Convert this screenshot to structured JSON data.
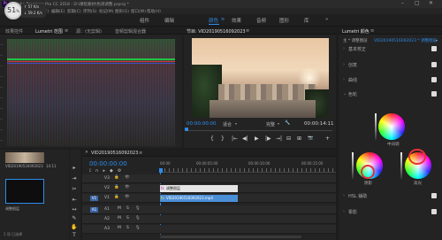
{
  "titlebar": {
    "app": "Pr",
    "title": "Adobe Premiere Pro CC 2018 - D:\\课程素材\\色调调整.prproj *"
  },
  "menu": [
    "文件(F)",
    "编辑(E)",
    "剪辑(C)",
    "序列(S)",
    "标记(M)",
    "图形(G)",
    "窗口(W)",
    "帮助(H)"
  ],
  "workspaces": {
    "items": [
      "组件",
      "编辑",
      "颜色",
      "效果",
      "音频",
      "图形",
      "库"
    ],
    "active_index": 2,
    "more": "»"
  },
  "speed_badge": {
    "percent": "51",
    "unit": "%",
    "up": "↑ 57 K/s",
    "down": "↓ 59.2 K/s"
  },
  "scopes_panel": {
    "tabs": [
      "效果控件",
      "Lumetri 范围",
      "源：(无剪辑)",
      "音频剪辑混合器"
    ],
    "active_index": 1,
    "menu": "≡"
  },
  "program_panel": {
    "title": "节目: VID20190516092023",
    "menu": "≡",
    "timecode_left": "00:00:00:00",
    "zoom": "适合",
    "quality": "完整",
    "timecode_right": "00:00:14:11",
    "wrench": "🔧"
  },
  "transport": [
    "{",
    "}",
    "|←",
    "◀|",
    "▶",
    "|▶",
    "→|",
    "⊟",
    "⊞",
    "📷",
    "+"
  ],
  "lumetri": {
    "title": "Lumetri 颜色",
    "menu": "≡",
    "master_label": "主 * 调整图层",
    "clip_label": "VID20190516092023 * 调整图层",
    "sections": [
      {
        "label": "基本校正",
        "checked": true
      },
      {
        "label": "创意",
        "checked": true
      },
      {
        "label": "曲线",
        "checked": true
      },
      {
        "label": "色轮",
        "checked": true
      }
    ],
    "hsl_label": "HSL 辅助",
    "vignette_label": "晕影",
    "wheel_labels": {
      "shadows": "阴影",
      "midtones": "中间调",
      "highlights": "高光"
    }
  },
  "project_panel": {
    "clip_name": "VID20190516092023",
    "clip_duration": "14:11",
    "bin_name": "调整图层",
    "bin_duration": "",
    "footer": "1 项 已选择"
  },
  "timeline": {
    "sequence_name": "VID20190516092023",
    "menu": "≡",
    "timecode": "00:00:00:00",
    "ruler": [
      "00:00",
      "00:00:05:00",
      "00:00:10:00",
      "00:00:15:00"
    ],
    "video_tracks": [
      "V3",
      "V2",
      "V1"
    ],
    "audio_tracks": [
      "A1",
      "A2",
      "A3"
    ],
    "adjustment_clip": "调整图层",
    "video_clip": "VID20190516092023.mp4"
  },
  "tools": [
    "▸",
    "⇥",
    "✂",
    "⇤",
    "↔",
    "✎",
    "✋",
    "T"
  ],
  "colors": {
    "accent": "#2d8ceb",
    "panel": "#232323",
    "clip_adj": "#e6e6e6",
    "clip_video": "#4b8fd6",
    "audio_on": "#3a66a8"
  }
}
